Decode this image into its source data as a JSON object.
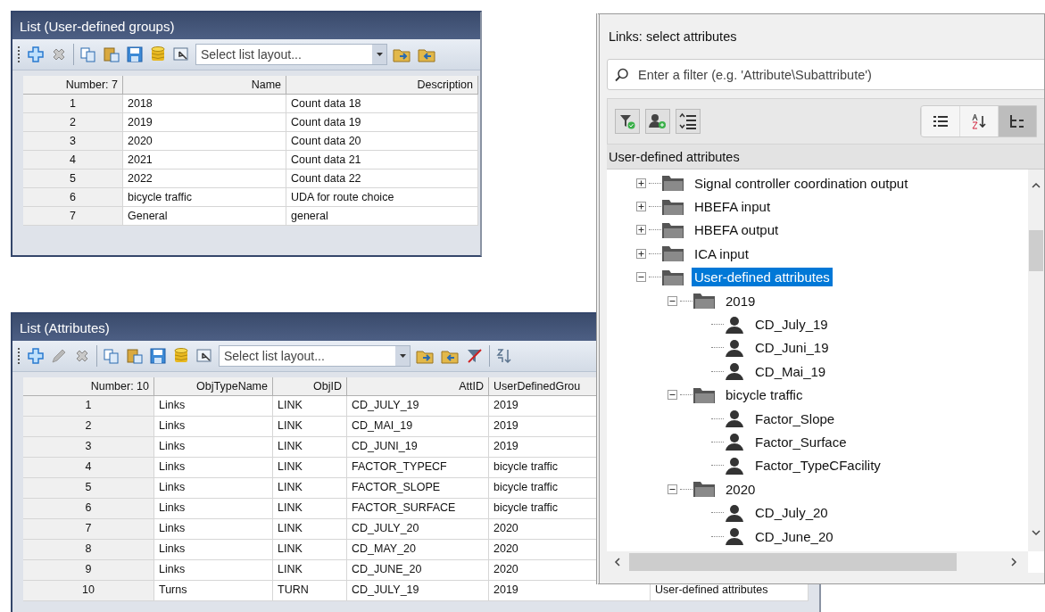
{
  "groups_window": {
    "title": "List (User-defined groups)",
    "layout_select": {
      "placeholder": "Select list layout..."
    },
    "table": {
      "columns": [
        "Number: 7",
        "Name",
        "Description"
      ],
      "rows": [
        [
          "1",
          "2018",
          "Count data 18"
        ],
        [
          "2",
          "2019",
          "Count data 19"
        ],
        [
          "3",
          "2020",
          "Count data 20"
        ],
        [
          "4",
          "2021",
          "Count data 21"
        ],
        [
          "5",
          "2022",
          "Count data 22"
        ],
        [
          "6",
          "bicycle traffic",
          "UDA for route choice"
        ],
        [
          "7",
          "General",
          "general"
        ]
      ]
    }
  },
  "attributes_window": {
    "title": "List (Attributes)",
    "layout_select": {
      "placeholder": "Select list layout..."
    },
    "table": {
      "columns": [
        "Number: 10",
        "ObjTypeName",
        "ObjID",
        "AttID",
        "UserDefinedGrou"
      ],
      "rows": [
        [
          "1",
          "Links",
          "LINK",
          "CD_JULY_19",
          "2019"
        ],
        [
          "2",
          "Links",
          "LINK",
          "CD_MAI_19",
          "2019"
        ],
        [
          "3",
          "Links",
          "LINK",
          "CD_JUNI_19",
          "2019"
        ],
        [
          "4",
          "Links",
          "LINK",
          "FACTOR_TYPECF",
          "bicycle traffic"
        ],
        [
          "5",
          "Links",
          "LINK",
          "FACTOR_SLOPE",
          "bicycle traffic"
        ],
        [
          "6",
          "Links",
          "LINK",
          "FACTOR_SURFACE",
          "bicycle traffic"
        ],
        [
          "7",
          "Links",
          "LINK",
          "CD_JULY_20",
          "2020"
        ],
        [
          "8",
          "Links",
          "LINK",
          "CD_MAY_20",
          "2020"
        ],
        [
          "9",
          "Links",
          "LINK",
          "CD_JUNE_20",
          "2020"
        ],
        [
          "10",
          "Turns",
          "TURN",
          "CD_JULY_19",
          "2019",
          "User-defined attributes"
        ]
      ]
    }
  },
  "dialog": {
    "title": "Links: select attributes",
    "filter": {
      "placeholder": "Enter a filter (e.g. 'Attribute\\Subattribute')"
    },
    "view_buttons": [
      {
        "kind": "list",
        "selected": false
      },
      {
        "kind": "sort",
        "selected": false
      },
      {
        "kind": "tree",
        "selected": true
      }
    ],
    "tree_header": "User-defined attributes",
    "tree": [
      {
        "kind": "folder",
        "label": "Signal controller coordination output",
        "expanded": false,
        "selected": false
      },
      {
        "kind": "folder",
        "label": "HBEFA input",
        "expanded": false,
        "selected": false
      },
      {
        "kind": "folder",
        "label": "HBEFA output",
        "expanded": false,
        "selected": false
      },
      {
        "kind": "folder",
        "label": "ICA input",
        "expanded": false,
        "selected": false
      },
      {
        "kind": "folder",
        "label": "User-defined attributes",
        "expanded": true,
        "selected": true,
        "children": [
          {
            "kind": "folder",
            "label": "2019",
            "expanded": true,
            "selected": false,
            "children": [
              {
                "kind": "attribute",
                "label": "CD_July_19",
                "selected": false
              },
              {
                "kind": "attribute",
                "label": "CD_Juni_19",
                "selected": false
              },
              {
                "kind": "attribute",
                "label": "CD_Mai_19",
                "selected": false
              }
            ]
          },
          {
            "kind": "folder",
            "label": "bicycle traffic",
            "expanded": true,
            "selected": false,
            "children": [
              {
                "kind": "attribute",
                "label": "Factor_Slope",
                "selected": false
              },
              {
                "kind": "attribute",
                "label": "Factor_Surface",
                "selected": false
              },
              {
                "kind": "attribute",
                "label": "Factor_TypeCFacility",
                "selected": false
              }
            ]
          },
          {
            "kind": "folder",
            "label": "2020",
            "expanded": true,
            "selected": false,
            "children": [
              {
                "kind": "attribute",
                "label": "CD_July_20",
                "selected": false
              },
              {
                "kind": "attribute",
                "label": "CD_June_20",
                "selected": false
              }
            ]
          }
        ]
      }
    ]
  }
}
